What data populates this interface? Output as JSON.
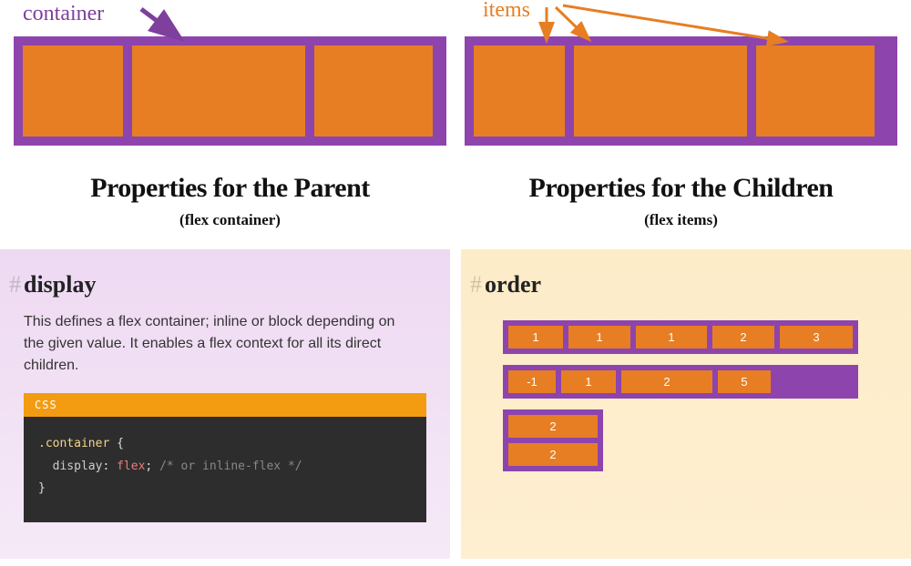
{
  "top": {
    "container_label": "container",
    "items_label": "items"
  },
  "headings": {
    "parent_title": "Properties for the Parent",
    "parent_sub": "(flex container)",
    "children_title": "Properties for the Children",
    "children_sub": "(flex items)"
  },
  "display_panel": {
    "title": "display",
    "description": "This defines a flex container; inline or block depending on the given value. It enables a flex context for all its direct children.",
    "code_lang": "CSS",
    "code": {
      "selector": ".container",
      "prop": "display",
      "value": "flex",
      "comment": "/* or inline-flex */"
    }
  },
  "order_panel": {
    "title": "order",
    "rows": [
      [
        "1",
        "1",
        "1",
        "2",
        "3"
      ],
      [
        "-1",
        "1",
        "2",
        "5"
      ],
      [
        "2",
        "2"
      ]
    ]
  },
  "colors": {
    "purple": "#8e44ad",
    "orange": "#e77e23",
    "header_orange": "#f39c12"
  }
}
